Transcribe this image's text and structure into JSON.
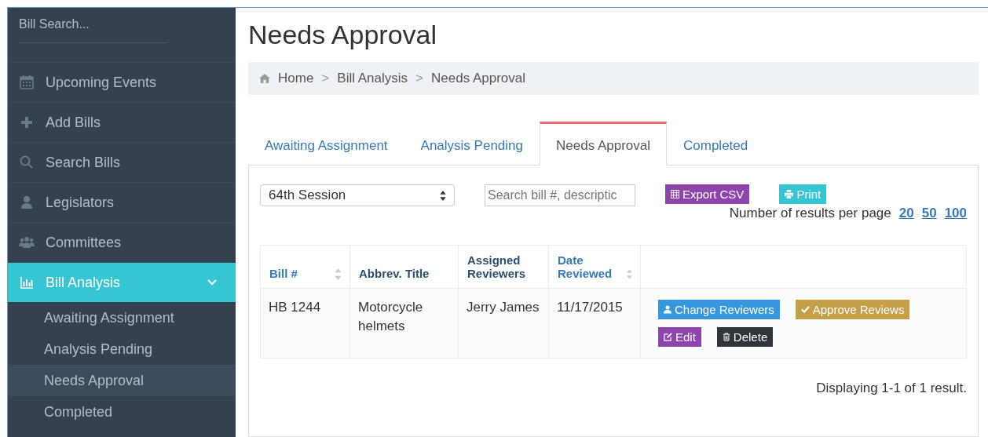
{
  "sidebar": {
    "search": {
      "placeholder": "Bill Search..."
    },
    "items": [
      {
        "label": "Upcoming Events",
        "selected": false
      },
      {
        "label": "Add Bills",
        "selected": false
      },
      {
        "label": "Search Bills",
        "selected": false
      },
      {
        "label": "Legislators",
        "selected": false
      },
      {
        "label": "Committees",
        "selected": false
      },
      {
        "label": "Bill Analysis",
        "selected": true,
        "expanded": true,
        "children": [
          {
            "label": "Awaiting Assignment",
            "selected": false
          },
          {
            "label": "Analysis Pending",
            "selected": false
          },
          {
            "label": "Needs Approval",
            "selected": true
          },
          {
            "label": "Completed",
            "selected": false
          }
        ]
      }
    ]
  },
  "page": {
    "title": "Needs Approval",
    "breadcrumb": [
      "Home",
      "Bill Analysis",
      "Needs Approval"
    ],
    "separator": ">",
    "tabs": [
      {
        "label": "Awaiting Assignment",
        "selected": false
      },
      {
        "label": "Analysis Pending",
        "selected": false
      },
      {
        "label": "Needs Approval",
        "selected": true
      },
      {
        "label": "Completed",
        "selected": false
      }
    ],
    "session_select": {
      "value": "64th Session"
    },
    "search": {
      "placeholder": "Search bill #, descriptic"
    },
    "export_button": "Export CSV",
    "print_button": "Print",
    "per_page": {
      "label": "Number of results per page",
      "options": [
        "20",
        "50",
        "100"
      ]
    },
    "table": {
      "columns": [
        {
          "label": "Bill #",
          "sortable": true
        },
        {
          "label": "Abbrev. Title",
          "sortable": false
        },
        {
          "label": "Assigned Reviewers",
          "sortable": false
        },
        {
          "label": "Date Reviewed",
          "sortable": true
        },
        {
          "sortable": false
        }
      ],
      "rows": [
        {
          "bill": "HB 1244",
          "title": "Motorcycle helmets",
          "reviewers": "Jerry James",
          "date": "11/17/2015",
          "actions": [
            {
              "kind": "reviewers",
              "label": "Change Reviewers",
              "color": "#3598dc"
            },
            {
              "kind": "approve",
              "label": "Approve Reviews",
              "color": "#c49f47"
            },
            {
              "kind": "edit",
              "label": "Edit",
              "color": "#8e44ad"
            },
            {
              "kind": "delete",
              "label": "Delete",
              "color": "#2f353b"
            }
          ]
        }
      ]
    },
    "footer": "Displaying 1-1 of 1 result."
  }
}
